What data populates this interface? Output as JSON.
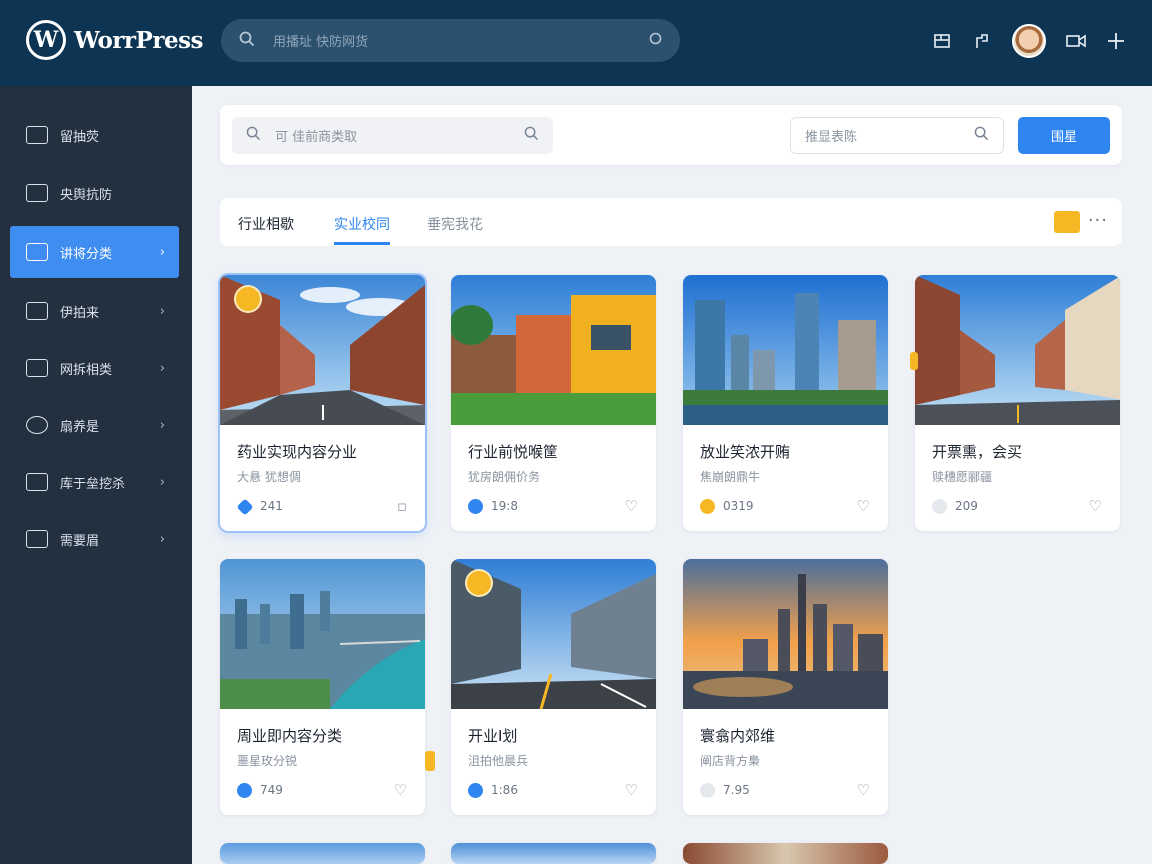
{
  "app": {
    "brand_name": "WorrPress",
    "brand_letter": "W"
  },
  "topbar": {
    "search_placeholder": "用播址 快防网货",
    "icons": [
      "search-icon",
      "pages-icon",
      "edit-icon",
      "avatar",
      "media-icon",
      "add-icon"
    ]
  },
  "sidebar": {
    "items": [
      {
        "label": "留抽荧",
        "icon": "dashboard-icon",
        "active": false,
        "has_chevron": false
      },
      {
        "label": "央舆抗防",
        "icon": "lock-icon",
        "active": false,
        "has_chevron": false
      },
      {
        "label": "讲将分类",
        "icon": "image-icon",
        "active": true,
        "has_chevron": true
      },
      {
        "label": "伊拍来",
        "icon": "shield-icon",
        "active": false,
        "has_chevron": true
      },
      {
        "label": "网拆相类",
        "icon": "folder-icon",
        "active": false,
        "has_chevron": true
      },
      {
        "label": "扇养是",
        "icon": "globe-icon",
        "active": false,
        "has_chevron": true
      },
      {
        "label": "库于垒挖杀",
        "icon": "tool-icon",
        "active": false,
        "has_chevron": true
      },
      {
        "label": "需要眉",
        "icon": "settings-icon",
        "active": false,
        "has_chevron": true
      }
    ]
  },
  "filter": {
    "search_placeholder": "可 佳前商类取",
    "secondary_placeholder": "推显表陈",
    "button_label": "围星"
  },
  "tabs": {
    "items": [
      {
        "label": "行业相歇",
        "state": "normal"
      },
      {
        "label": "实业校同",
        "state": "active"
      },
      {
        "label": "垂宪我花",
        "state": "muted"
      }
    ],
    "more": "···"
  },
  "cards": [
    {
      "title": "药业实现内容分业",
      "subtitle": "大悬 犹想倜",
      "count": "241",
      "dot_color": "#2f86f0",
      "pinned": true,
      "selected": true,
      "scene": "street"
    },
    {
      "title": "行业前悦喉筐",
      "subtitle": "犹房朗佣价务",
      "count": "19:8",
      "dot_color": "#2f86f0",
      "pinned": false,
      "selected": false,
      "scene": "campus"
    },
    {
      "title": "放业笑浓开贿",
      "subtitle": "焦崩朗鼎牛",
      "count": "0319",
      "dot_color": "#f5b824",
      "pinned": false,
      "selected": false,
      "scene": "skyline"
    },
    {
      "title": "开票熏，会买",
      "subtitle": "赎穗愿郦疆",
      "count": "209",
      "dot_color": "#e5e8ec",
      "pinned": false,
      "selected": false,
      "scene": "street2"
    },
    {
      "title": "周业即内容分类",
      "subtitle": "噩星玫分锐",
      "count": "749",
      "dot_color": "#2f86f0",
      "pinned": false,
      "selected": false,
      "scene": "river"
    },
    {
      "title": "开业Ⅰ划",
      "subtitle": "沮拍他晨兵",
      "count": "1:86",
      "dot_color": "#2f86f0",
      "pinned": true,
      "selected": false,
      "scene": "road"
    },
    {
      "title": "寰翕内郊维",
      "subtitle": "阐店背方梟",
      "count": "7.95",
      "dot_color": "#e5e8ec",
      "pinned": false,
      "selected": false,
      "scene": "sunset"
    }
  ],
  "colors": {
    "topbar": "#0d3553",
    "sidebar": "#23303f",
    "accent": "#2f86f0",
    "highlight": "#f5b824"
  }
}
